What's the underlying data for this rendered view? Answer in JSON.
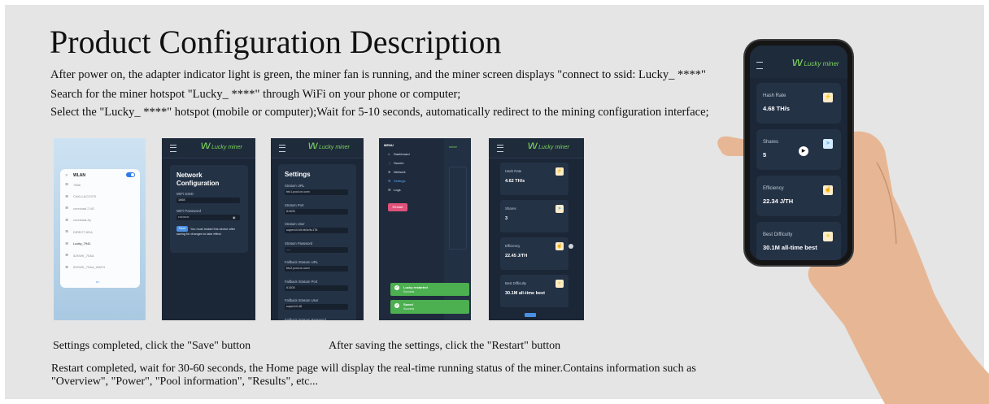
{
  "title": "Product Configuration Description",
  "lines": [
    "After power on, the adapter indicator light is green, the miner fan is running, and the miner screen displays \"connect to ssid: Lucky_ ****\"",
    "Search for the miner hotspot \"Lucky_ ****\" through WiFi on your phone or computer;",
    "Select the \"Lucky_ ****\" hotspot (mobile or computer);Wait for 5-10 seconds, automatically redirect to the mining configuration interface;"
  ],
  "captions": {
    "save": "Settings completed, click the \"Save\" button",
    "restart": "After saving the settings, click the \"Restart\" button"
  },
  "paragraph": "Restart completed, wait for 30-60 seconds, the Home page will display the real-time running status of the miner.Contains information such as \"Overview\", \"Power\", \"Pool information\", \"Results\", etc...",
  "brand": "Lucky miner",
  "wlan": {
    "header": "WLAN",
    "networks": [
      "7668",
      "CAKLLACO375",
      "connload 2.4G",
      "connload-ihj",
      "DIRECT-6DA",
      "Lucky_7941",
      "52KWK_70AA",
      "52KWK_70AA_WAP4"
    ]
  },
  "network": {
    "title": "Network Configuration",
    "ssid_label": "WiFi SSID",
    "ssid_value": "1668",
    "pw_label": "WiFi Password",
    "pw_value": "••••••••••",
    "save_label": "Save",
    "note": "You must restart this device after saving for changes to take effect."
  },
  "settings": {
    "title": "Settings",
    "fields": [
      {
        "label": "Stratum URL",
        "value": "btc1.pool.cn.com"
      },
      {
        "label": "Stratum Port",
        "value": "61305"
      },
      {
        "label": "Stratum User",
        "value": "super44.bit.hb3c9c178"
      },
      {
        "label": "Stratum Password",
        "value": "----"
      },
      {
        "label": "Fallback Stratum URL",
        "value": "btc2.pool.cn.com"
      },
      {
        "label": "Fallback Stratum Port",
        "value": "61305"
      },
      {
        "label": "Fallback Stratum User",
        "value": "super44.48"
      },
      {
        "label": "Fallback Stratum Password",
        "value": ""
      }
    ]
  },
  "menu": {
    "header": "MENU",
    "items": [
      "Dashboard",
      "Swarm",
      "Network",
      "Settings",
      "Logs"
    ],
    "restart": "Restart",
    "toast1_title": "Lucky restarted",
    "toast1_sub": "Success",
    "toast2_title": "Saved",
    "toast2_sub": "Success"
  },
  "dash_small": [
    {
      "label": "Hash Rate",
      "value": "4.62 TH/s"
    },
    {
      "label": "Shares",
      "value": "3"
    },
    {
      "label": "Efficiency",
      "value": "22.45 J/TH"
    },
    {
      "label": "Best Difficulty",
      "value": "30.1M all-time best"
    }
  ],
  "dash_phone": [
    {
      "label": "Hash Rate",
      "value": "4.68 TH/s"
    },
    {
      "label": "Shares",
      "value": "5"
    },
    {
      "label": "Efficiency",
      "value": "22.34 J/TH"
    },
    {
      "label": "Best Difficulty",
      "value": "30.1M all-time best"
    }
  ],
  "colors": {
    "accent_green": "#7cd35d",
    "app_bg": "#1b2636",
    "card_bg": "#243246",
    "save_blue": "#4a90e2",
    "restart_pink": "#e0527a",
    "toast_green": "#4caf50"
  }
}
